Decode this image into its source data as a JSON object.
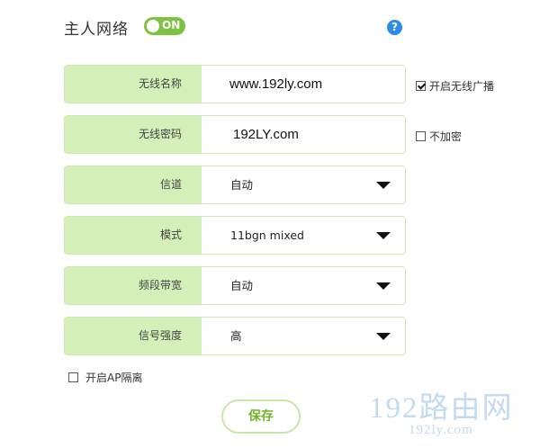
{
  "header": {
    "title": "主人网络",
    "toggle_label": "ON",
    "help_icon": "?"
  },
  "fields": [
    {
      "label": "无线名称",
      "value": "www.192ly.com",
      "type": "text"
    },
    {
      "label": "无线密码",
      "value": "192LY.com",
      "type": "text"
    },
    {
      "label": "信道",
      "value": "自动",
      "type": "select"
    },
    {
      "label": "模式",
      "value": "11bgn mixed",
      "type": "select"
    },
    {
      "label": "频段带宽",
      "value": "自动",
      "type": "select"
    },
    {
      "label": "信号强度",
      "value": "高",
      "type": "select"
    }
  ],
  "options": {
    "broadcast": {
      "label": "开启无线广播",
      "checked": true
    },
    "no_encrypt": {
      "label": "不加密",
      "checked": false
    },
    "ap_isolation": {
      "label": "开启AP隔离",
      "checked": false
    }
  },
  "save_label": "保存",
  "watermark": {
    "main": "192路由网",
    "sub": "192ly.com"
  },
  "colors": {
    "accent": "#7dc242",
    "label_bg": "#d4efb7",
    "help": "#2e8ce6"
  }
}
